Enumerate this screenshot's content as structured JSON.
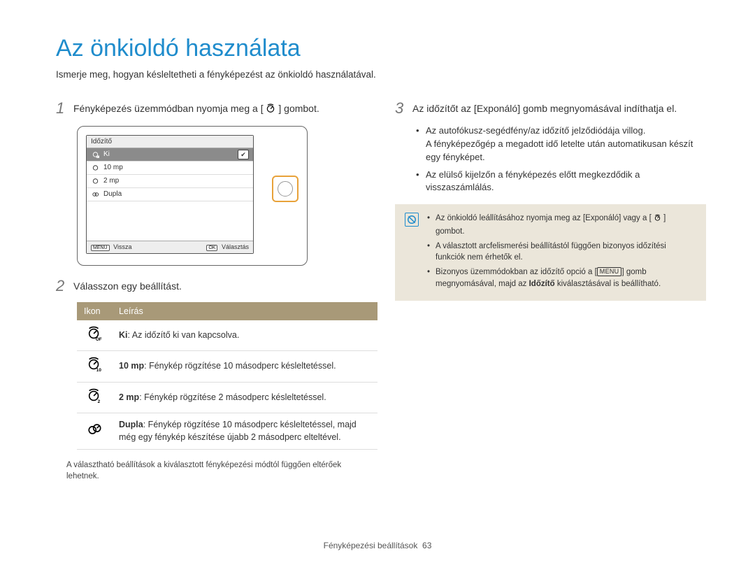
{
  "title": "Az önkioldó használata",
  "subtitle": "Ismerje meg, hogyan késleltetheti a fényképezést az önkioldó használatával.",
  "steps": {
    "s1": {
      "num": "1",
      "text_before": "Fényképezés üzemmódban nyomja meg a [",
      "text_after": "] gombot."
    },
    "s2": {
      "num": "2",
      "text": "Válasszon egy beállítást."
    },
    "s3": {
      "num": "3",
      "text": "Az időzítőt az [Exponáló] gomb megnyomásával indíthatja el."
    }
  },
  "camera_menu": {
    "header": "Időzítő",
    "items": [
      "Ki",
      "10 mp",
      "2 mp",
      "Dupla"
    ],
    "footer_left_chip": "MENU",
    "footer_left": "Vissza",
    "footer_right_chip": "OK",
    "footer_right": "Választás"
  },
  "table": {
    "head_icon": "Ikon",
    "head_desc": "Leírás",
    "rows": [
      {
        "term": "Ki",
        "rest": ": Az időzítő ki van kapcsolva."
      },
      {
        "term": "10 mp",
        "rest": ": Fénykép rögzítése 10 másodperc késleltetéssel."
      },
      {
        "term": "2 mp",
        "rest": ": Fénykép rögzítése 2 másodperc késleltetéssel."
      },
      {
        "term": "Dupla",
        "rest": ": Fénykép rögzítése 10 másodperc késleltetéssel, majd még egy fénykép készítése újabb 2 másodperc elteltével."
      }
    ]
  },
  "table_note": "A választható beállítások a kiválasztott fényképezési módtól függően eltérőek lehetnek.",
  "right_bullets": [
    {
      "l1": "Az autofókusz-segédfény/az időzítő jelződiódája villog.",
      "l2": "A fényképezőgép a megadott idő letelte után automatikusan készít egy fényképet."
    },
    {
      "l1": "Az elülső kijelzőn a fényképezés előtt megkezdődik a visszaszámlálás."
    }
  ],
  "info": {
    "i1_before": "Az önkioldó leállításához nyomja meg az [Exponáló] vagy a [",
    "i1_after": "] gombot.",
    "i2": "A választott arcfelismerési beállítástól függően bizonyos időzítési funkciók nem érhetők el.",
    "i3_before": "Bizonyos üzemmódokban az időzítő opció a [",
    "i3_mid": "] gomb megnyomásával, majd az ",
    "i3_bold": "Időzítő",
    "i3_after": " kiválasztásával is beállítható.",
    "menu_chip": "MENU"
  },
  "footer": {
    "label": "Fényképezési beállítások",
    "page": "63"
  }
}
